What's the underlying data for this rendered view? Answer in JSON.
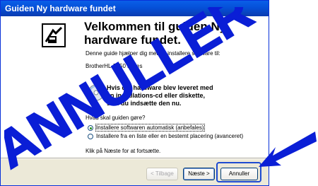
{
  "window": {
    "title": "Guiden Ny hardware fundet"
  },
  "content": {
    "heading": "Velkommen til guiden Ny hardware fundet.",
    "intro": "Denne guide hjælper dig med at installere software til:",
    "device": "BrotherHL-7050 series",
    "cd_prompt_line1": "Hvis din hardware blev leveret med",
    "cd_prompt_line2": "en installations-cd eller diskette,",
    "cd_prompt_line3": "skal du indsætte den nu.",
    "question": "Hvad skal guiden gøre?",
    "options": [
      {
        "label": "Installere softwaren automatisk (anbefales)",
        "selected": true
      },
      {
        "label": "Installere fra en liste eller en bestemt placering (avanceret)",
        "selected": false
      }
    ],
    "footer": "Klik på Næste for at fortsætte."
  },
  "buttons": {
    "back": "< Tilbage",
    "next": "Næste >",
    "cancel": "Annuller"
  },
  "overlay": {
    "stamp_text": "ANNULLER",
    "stamp_color": "#0a1ed6"
  }
}
